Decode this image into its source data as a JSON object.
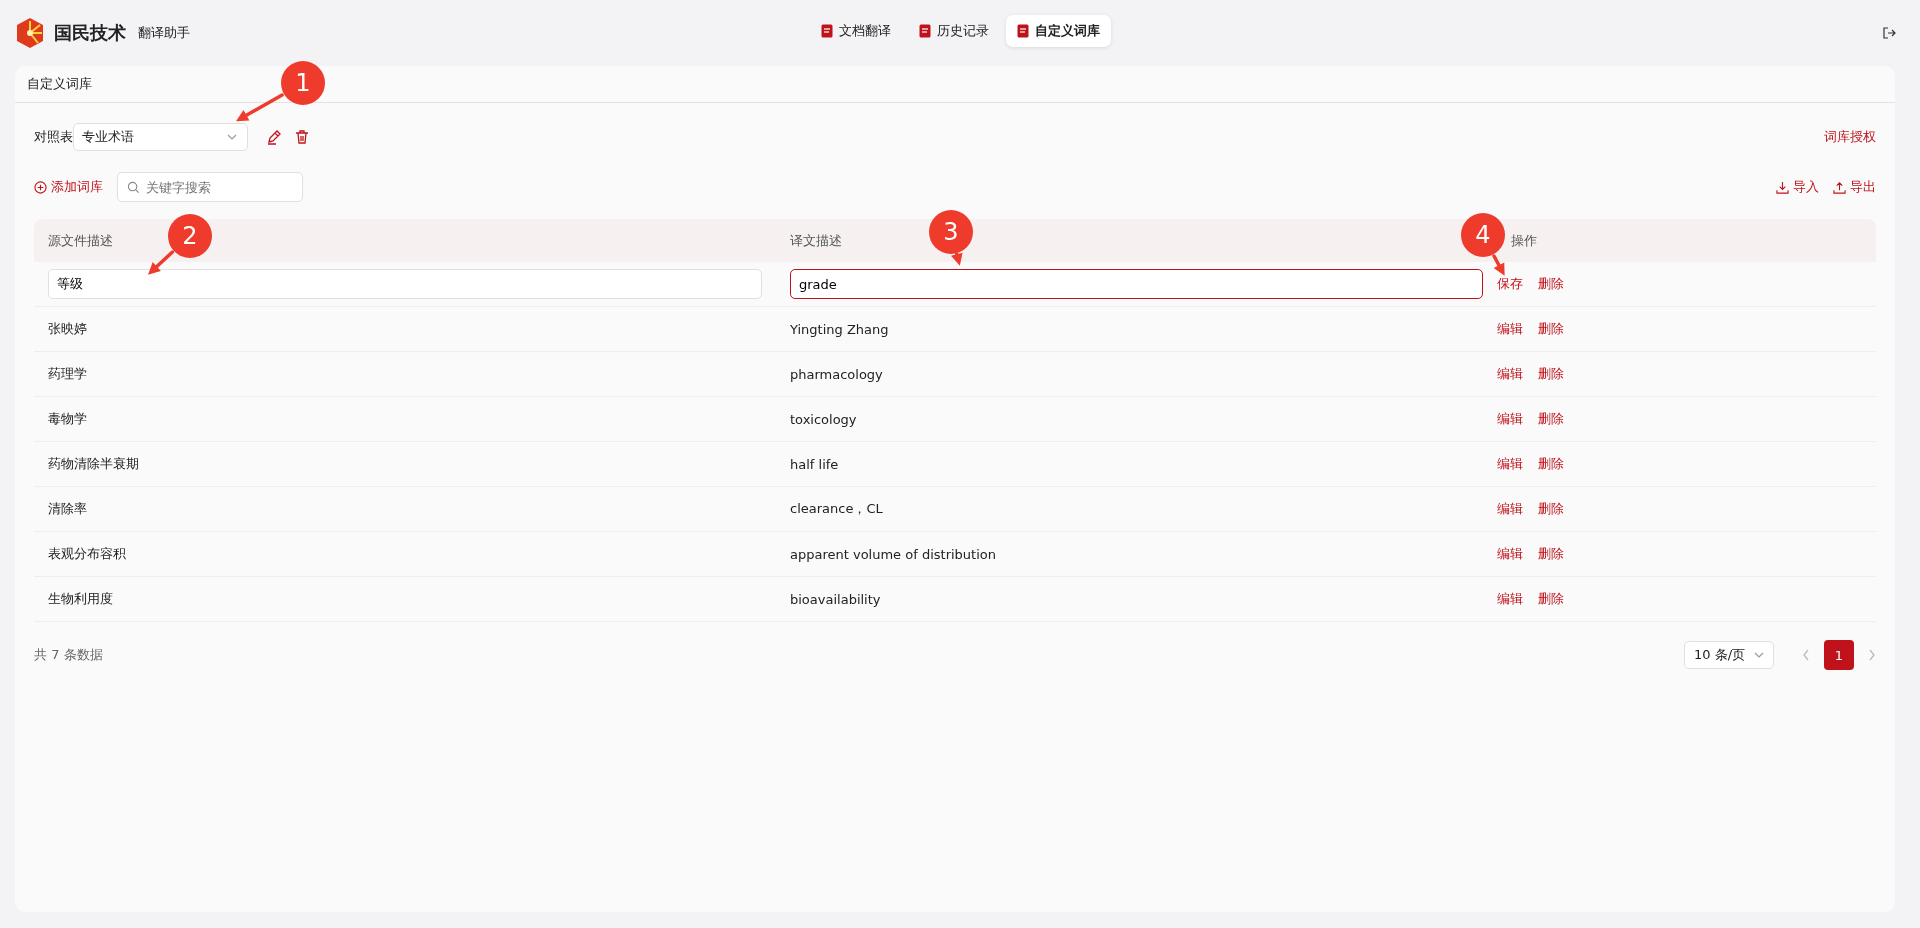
{
  "header": {
    "brand": "国民技术",
    "subtitle": "翻译助手",
    "tabs": [
      {
        "label": "文档翻译",
        "selected": false
      },
      {
        "label": "历史记录",
        "selected": false
      },
      {
        "label": "自定义词库",
        "selected": true
      }
    ]
  },
  "card": {
    "title": "自定义词库",
    "selector": {
      "label": "对照表",
      "value": "专业术语",
      "authorize_link": "词库授权"
    },
    "toolbar": {
      "add_button": "添加词库",
      "search": {
        "placeholder": "关键字搜索"
      },
      "import_button": "导入",
      "export_button": "导出"
    },
    "table": {
      "columns": [
        "源文件描述",
        "译文描述",
        "操作"
      ],
      "rows": [
        {
          "kind": "edit",
          "source": "等级",
          "target": "grade",
          "target_focused": true,
          "actions": [
            "保存",
            "删除"
          ]
        },
        {
          "kind": "view",
          "source": "张映婷",
          "target": "Yingting Zhang",
          "actions": [
            "编辑",
            "删除"
          ]
        },
        {
          "kind": "view",
          "source": "药理学",
          "target": "pharmacology",
          "actions": [
            "编辑",
            "删除"
          ]
        },
        {
          "kind": "view",
          "source": "毒物学",
          "target": "toxicology",
          "actions": [
            "编辑",
            "删除"
          ]
        },
        {
          "kind": "view",
          "source": "药物清除半衰期",
          "target": "half life",
          "actions": [
            "编辑",
            "删除"
          ]
        },
        {
          "kind": "view",
          "source": "清除率",
          "target": "clearance，CL",
          "actions": [
            "编辑",
            "删除"
          ]
        },
        {
          "kind": "view",
          "source": "表观分布容积",
          "target": "apparent volume of distribution",
          "actions": [
            "编辑",
            "删除"
          ]
        },
        {
          "kind": "view",
          "source": "生物利用度",
          "target": "bioavailability",
          "actions": [
            "编辑",
            "删除"
          ]
        }
      ]
    },
    "footer": {
      "total": "共 7 条数据",
      "page_size": "10 条/页",
      "pages": [
        {
          "label": "1",
          "selected": true
        }
      ]
    }
  },
  "callouts": [
    {
      "number": "1"
    },
    {
      "number": "2"
    },
    {
      "number": "3"
    },
    {
      "number": "4"
    }
  ]
}
